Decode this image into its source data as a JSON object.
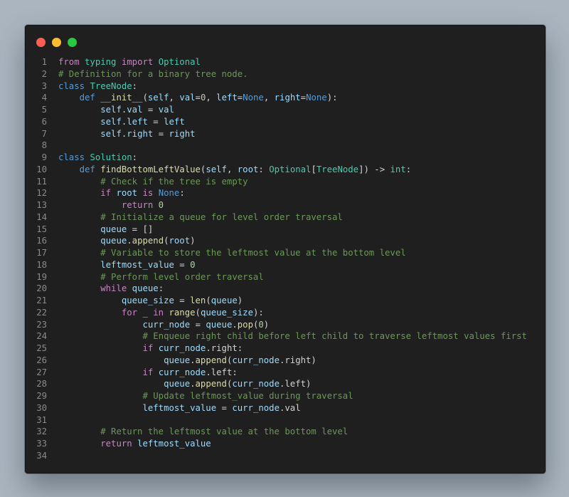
{
  "window": {
    "controls": {
      "close": "close-icon",
      "minimize": "minimize-icon",
      "maximize": "maximize-icon"
    },
    "colors": {
      "background": "#1f1f1f",
      "close": "#ff5f57",
      "minimize": "#febc2e",
      "maximize": "#28c840"
    }
  },
  "code": {
    "language": "python",
    "lines": [
      [
        [
          "k",
          "from"
        ],
        [
          "p",
          " "
        ],
        [
          "t",
          "typing"
        ],
        [
          "p",
          " "
        ],
        [
          "k",
          "import"
        ],
        [
          "p",
          " "
        ],
        [
          "t",
          "Optional"
        ]
      ],
      [
        [
          "c",
          "# Definition for a binary tree node."
        ]
      ],
      [
        [
          "kb",
          "class"
        ],
        [
          "p",
          " "
        ],
        [
          "t",
          "TreeNode"
        ],
        [
          "p",
          ":"
        ]
      ],
      [
        [
          "p",
          "    "
        ],
        [
          "kb",
          "def"
        ],
        [
          "p",
          " "
        ],
        [
          "f",
          "__init__"
        ],
        [
          "p",
          "("
        ],
        [
          "v",
          "self"
        ],
        [
          "p",
          ", "
        ],
        [
          "v",
          "val"
        ],
        [
          "p",
          "="
        ],
        [
          "n",
          "0"
        ],
        [
          "p",
          ", "
        ],
        [
          "v",
          "left"
        ],
        [
          "p",
          "="
        ],
        [
          "kb",
          "None"
        ],
        [
          "p",
          ", "
        ],
        [
          "v",
          "right"
        ],
        [
          "p",
          "="
        ],
        [
          "kb",
          "None"
        ],
        [
          "p",
          "):"
        ]
      ],
      [
        [
          "p",
          "        "
        ],
        [
          "v",
          "self"
        ],
        [
          "p",
          "."
        ],
        [
          "v",
          "val"
        ],
        [
          "p",
          " = "
        ],
        [
          "v",
          "val"
        ]
      ],
      [
        [
          "p",
          "        "
        ],
        [
          "v",
          "self"
        ],
        [
          "p",
          "."
        ],
        [
          "v",
          "left"
        ],
        [
          "p",
          " = "
        ],
        [
          "v",
          "left"
        ]
      ],
      [
        [
          "p",
          "        "
        ],
        [
          "v",
          "self"
        ],
        [
          "p",
          "."
        ],
        [
          "v",
          "right"
        ],
        [
          "p",
          " = "
        ],
        [
          "v",
          "right"
        ]
      ],
      [],
      [
        [
          "kb",
          "class"
        ],
        [
          "p",
          " "
        ],
        [
          "t",
          "Solution"
        ],
        [
          "p",
          ":"
        ]
      ],
      [
        [
          "p",
          "    "
        ],
        [
          "kb",
          "def"
        ],
        [
          "p",
          " "
        ],
        [
          "f",
          "findBottomLeftValue"
        ],
        [
          "p",
          "("
        ],
        [
          "v",
          "self"
        ],
        [
          "p",
          ", "
        ],
        [
          "v",
          "root"
        ],
        [
          "p",
          ": "
        ],
        [
          "t",
          "Optional"
        ],
        [
          "p",
          "["
        ],
        [
          "t",
          "TreeNode"
        ],
        [
          "p",
          "]) -> "
        ],
        [
          "t",
          "int"
        ],
        [
          "p",
          ":"
        ]
      ],
      [
        [
          "p",
          "        "
        ],
        [
          "c",
          "# Check if the tree is empty"
        ]
      ],
      [
        [
          "p",
          "        "
        ],
        [
          "k",
          "if"
        ],
        [
          "p",
          " "
        ],
        [
          "v",
          "root"
        ],
        [
          "p",
          " "
        ],
        [
          "k",
          "is"
        ],
        [
          "p",
          " "
        ],
        [
          "kb",
          "None"
        ],
        [
          "p",
          ":"
        ]
      ],
      [
        [
          "p",
          "            "
        ],
        [
          "k",
          "return"
        ],
        [
          "p",
          " "
        ],
        [
          "n",
          "0"
        ]
      ],
      [
        [
          "p",
          "        "
        ],
        [
          "c",
          "# Initialize a queue for level order traversal"
        ]
      ],
      [
        [
          "p",
          "        "
        ],
        [
          "v",
          "queue"
        ],
        [
          "p",
          " = []"
        ]
      ],
      [
        [
          "p",
          "        "
        ],
        [
          "v",
          "queue"
        ],
        [
          "p",
          "."
        ],
        [
          "f",
          "append"
        ],
        [
          "p",
          "("
        ],
        [
          "v",
          "root"
        ],
        [
          "p",
          ")"
        ]
      ],
      [
        [
          "p",
          "        "
        ],
        [
          "c",
          "# Variable to store the leftmost value at the bottom level"
        ]
      ],
      [
        [
          "p",
          "        "
        ],
        [
          "v",
          "leftmost_value"
        ],
        [
          "p",
          " = "
        ],
        [
          "n",
          "0"
        ]
      ],
      [
        [
          "p",
          "        "
        ],
        [
          "c",
          "# Perform level order traversal"
        ]
      ],
      [
        [
          "p",
          "        "
        ],
        [
          "k",
          "while"
        ],
        [
          "p",
          " "
        ],
        [
          "v",
          "queue"
        ],
        [
          "p",
          ":"
        ]
      ],
      [
        [
          "p",
          "            "
        ],
        [
          "v",
          "queue_size"
        ],
        [
          "p",
          " = "
        ],
        [
          "f",
          "len"
        ],
        [
          "p",
          "("
        ],
        [
          "v",
          "queue"
        ],
        [
          "p",
          ")"
        ]
      ],
      [
        [
          "p",
          "            "
        ],
        [
          "k",
          "for"
        ],
        [
          "p",
          " "
        ],
        [
          "v",
          "_"
        ],
        [
          "p",
          " "
        ],
        [
          "k",
          "in"
        ],
        [
          "p",
          " "
        ],
        [
          "f",
          "range"
        ],
        [
          "p",
          "("
        ],
        [
          "v",
          "queue_size"
        ],
        [
          "p",
          "):"
        ]
      ],
      [
        [
          "p",
          "                "
        ],
        [
          "v",
          "curr_node"
        ],
        [
          "p",
          " = "
        ],
        [
          "v",
          "queue"
        ],
        [
          "p",
          "."
        ],
        [
          "f",
          "pop"
        ],
        [
          "p",
          "("
        ],
        [
          "n",
          "0"
        ],
        [
          "p",
          ")"
        ]
      ],
      [
        [
          "p",
          "                "
        ],
        [
          "c",
          "# Enqueue right child before left child to traverse leftmost values first"
        ]
      ],
      [
        [
          "p",
          "                "
        ],
        [
          "k",
          "if"
        ],
        [
          "p",
          " "
        ],
        [
          "v",
          "curr_node"
        ],
        [
          "p",
          ".right:"
        ]
      ],
      [
        [
          "p",
          "                    "
        ],
        [
          "v",
          "queue"
        ],
        [
          "p",
          "."
        ],
        [
          "f",
          "append"
        ],
        [
          "p",
          "("
        ],
        [
          "v",
          "curr_node"
        ],
        [
          "p",
          ".right)"
        ]
      ],
      [
        [
          "p",
          "                "
        ],
        [
          "k",
          "if"
        ],
        [
          "p",
          " "
        ],
        [
          "v",
          "curr_node"
        ],
        [
          "p",
          ".left:"
        ]
      ],
      [
        [
          "p",
          "                    "
        ],
        [
          "v",
          "queue"
        ],
        [
          "p",
          "."
        ],
        [
          "f",
          "append"
        ],
        [
          "p",
          "("
        ],
        [
          "v",
          "curr_node"
        ],
        [
          "p",
          ".left)"
        ]
      ],
      [
        [
          "p",
          "                "
        ],
        [
          "c",
          "# Update leftmost_value during traversal"
        ]
      ],
      [
        [
          "p",
          "                "
        ],
        [
          "v",
          "leftmost_value"
        ],
        [
          "p",
          " = "
        ],
        [
          "v",
          "curr_node"
        ],
        [
          "p",
          ".val"
        ]
      ],
      [],
      [
        [
          "p",
          "        "
        ],
        [
          "c",
          "# Return the leftmost value at the bottom level"
        ]
      ],
      [
        [
          "p",
          "        "
        ],
        [
          "k",
          "return"
        ],
        [
          "p",
          " "
        ],
        [
          "v",
          "leftmost_value"
        ]
      ],
      []
    ]
  }
}
